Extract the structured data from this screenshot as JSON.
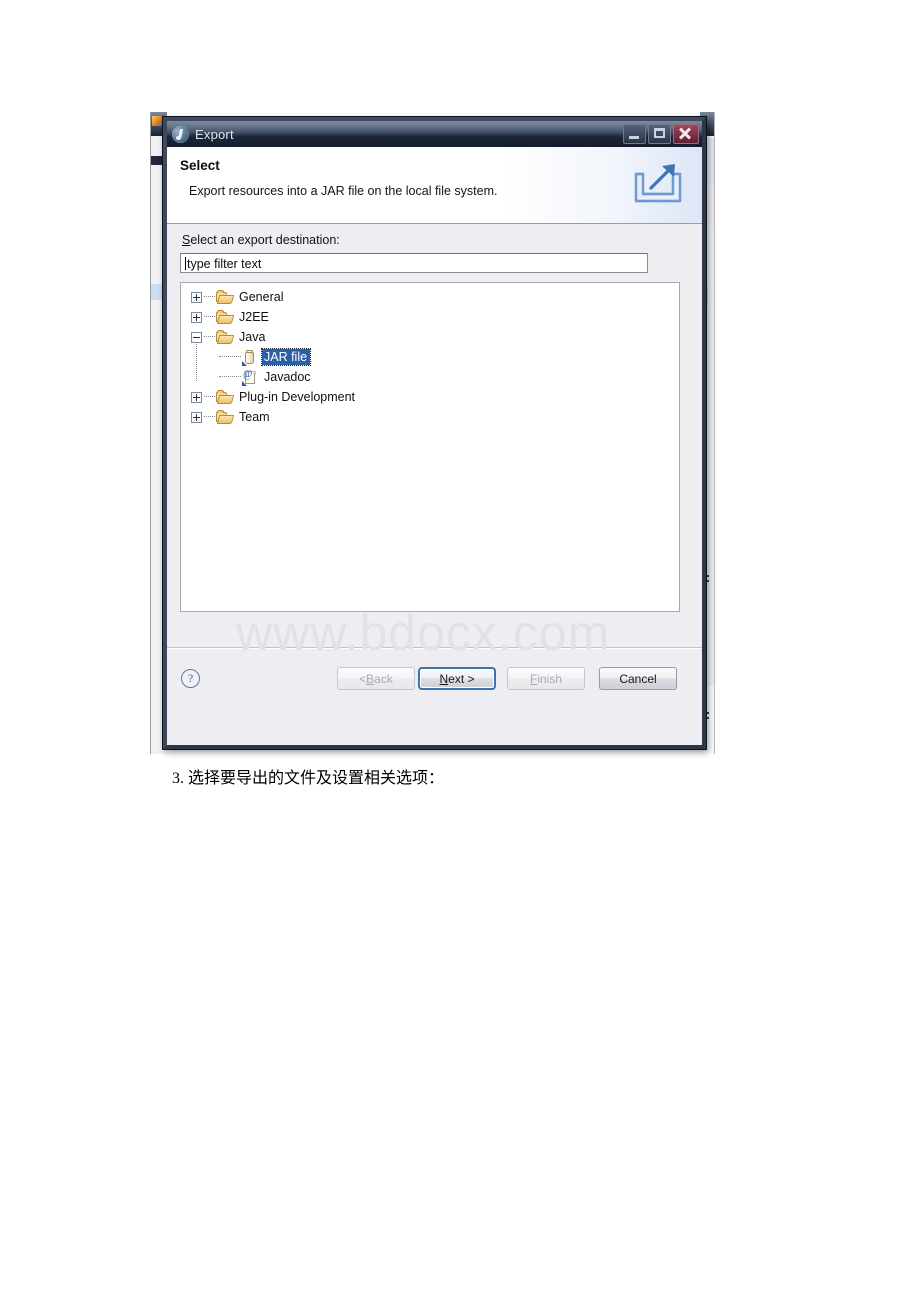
{
  "document": {
    "caption": "3. 选择要导出的文件及设置相关选项：",
    "watermark": "www.bdocx.com"
  },
  "dialog": {
    "title": "Export",
    "app_icon": "eclipse-icon",
    "window_buttons": [
      {
        "name": "minimize",
        "glyph": "minimize-icon"
      },
      {
        "name": "maximize",
        "glyph": "maximize-icon"
      },
      {
        "name": "close",
        "glyph": "close-icon"
      }
    ],
    "header": {
      "title": "Select",
      "description": "Export resources into a JAR file on the local file system.",
      "icon": "export-banner-icon"
    },
    "body": {
      "field_label_prefix": "S",
      "field_label_rest": "elect an export destination:",
      "filter": {
        "value": "type filter text",
        "placeholder": "type filter text"
      },
      "tree": [
        {
          "label": "General",
          "level": 0,
          "expander": "plus",
          "icon": "folder-icon",
          "selected": false
        },
        {
          "label": "J2EE",
          "level": 0,
          "expander": "plus",
          "icon": "folder-icon",
          "selected": false
        },
        {
          "label": "Java",
          "level": 0,
          "expander": "minus",
          "icon": "folder-icon",
          "selected": false
        },
        {
          "label": "JAR file",
          "level": 1,
          "expander": "none",
          "icon": "jar-icon",
          "selected": true
        },
        {
          "label": "Javadoc",
          "level": 1,
          "expander": "none",
          "icon": "javadoc-icon",
          "selected": false
        },
        {
          "label": "Plug-in Development",
          "level": 0,
          "expander": "plus",
          "icon": "folder-icon",
          "selected": false
        },
        {
          "label": "Team",
          "level": 0,
          "expander": "plus",
          "icon": "folder-icon",
          "selected": false
        }
      ]
    },
    "footer": {
      "help_glyph": "?",
      "buttons": [
        {
          "name": "back",
          "label_pre": "< ",
          "label_mnemonic": "B",
          "label_post": "ack",
          "state": "disabled"
        },
        {
          "name": "next",
          "label_pre": "",
          "label_mnemonic": "N",
          "label_post": "ext >",
          "state": "default"
        },
        {
          "name": "finish",
          "label_pre": "",
          "label_mnemonic": "F",
          "label_post": "inish",
          "state": "disabled"
        },
        {
          "name": "cancel",
          "label_pre": "",
          "label_mnemonic": "",
          "label_post": "Cancel",
          "state": "normal"
        }
      ]
    }
  },
  "colors": {
    "titlebar_dark": "#141b2c",
    "selection_blue": "#2b5fa8",
    "folder_amber": "#f0bf63",
    "dialog_bg": "#eeedf1",
    "close_red": "#7e2f44"
  }
}
